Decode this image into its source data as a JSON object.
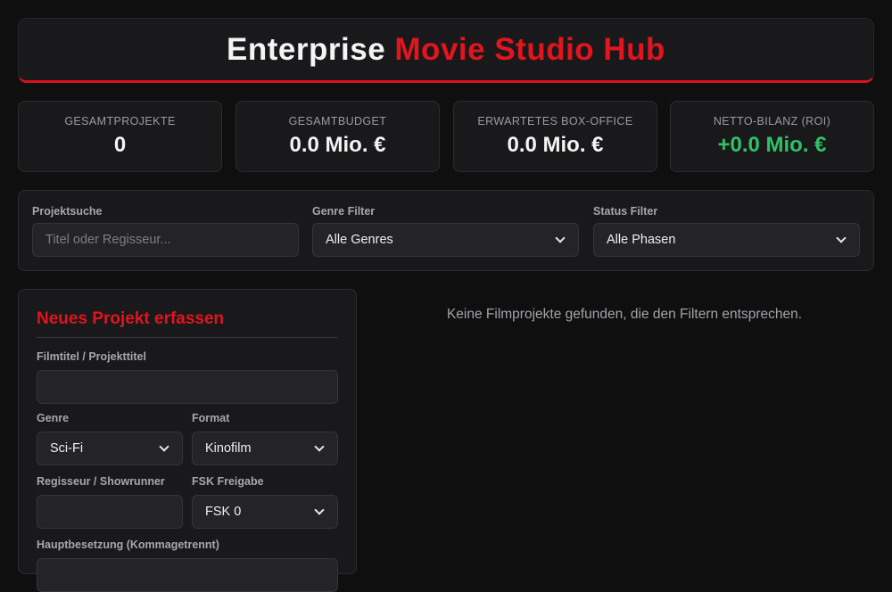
{
  "header": {
    "title_part1": "Enterprise",
    "title_part2": "Movie Studio Hub"
  },
  "stats": [
    {
      "label": "GESAMTPROJEKTE",
      "value": "0"
    },
    {
      "label": "GESAMTBUDGET",
      "value": "0.0 Mio. €"
    },
    {
      "label": "ERWARTETES BOX-OFFICE",
      "value": "0.0 Mio. €"
    },
    {
      "label": "NETTO-BILANZ (ROI)",
      "value": "+0.0 Mio. €"
    }
  ],
  "filters": {
    "search_label": "Projektsuche",
    "search_placeholder": "Titel oder Regisseur...",
    "genre_label": "Genre Filter",
    "genre_value": "Alle Genres",
    "status_label": "Status Filter",
    "status_value": "Alle Phasen"
  },
  "form": {
    "title": "Neues Projekt erfassen",
    "title_label": "Filmtitel / Projekttitel",
    "title_value": "",
    "genre_label": "Genre",
    "genre_value": "Sci-Fi",
    "format_label": "Format",
    "format_value": "Kinofilm",
    "director_label": "Regisseur / Showrunner",
    "director_value": "",
    "fsk_label": "FSK Freigabe",
    "fsk_value": "FSK 0",
    "cast_label": "Hauptbesetzung (Kommagetrennt)"
  },
  "empty_message": "Keine Filmprojekte gefunden, die den Filtern entsprechen.",
  "colors": {
    "accent": "#e2141c",
    "positive": "#2fc264",
    "background": "#0f0f10",
    "card": "#19191c"
  }
}
